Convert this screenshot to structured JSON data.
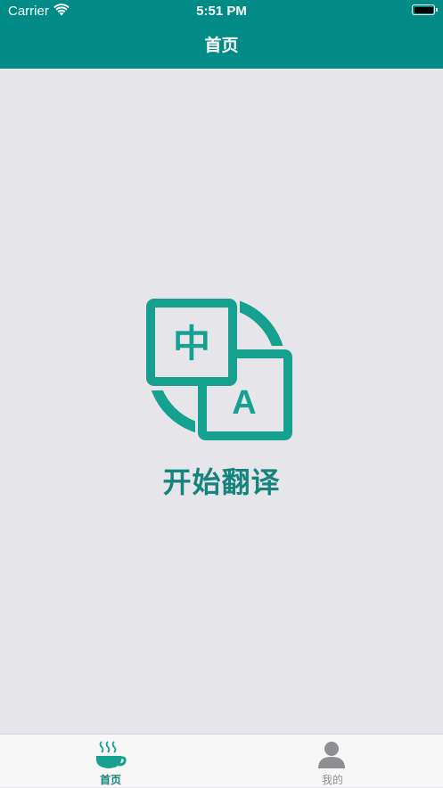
{
  "status_bar": {
    "carrier": "Carrier",
    "time": "5:51 PM"
  },
  "nav": {
    "title": "首页"
  },
  "main": {
    "icon": "translate-icon",
    "icon_chinese_char": "中",
    "icon_latin_char": "A",
    "start_label": "开始翻译"
  },
  "tabs": [
    {
      "label": "首页",
      "icon": "coffee-cup-icon",
      "active": true
    },
    {
      "label": "我的",
      "icon": "person-icon",
      "active": false
    }
  ],
  "colors": {
    "header": "#008b86",
    "accent": "#15a08f",
    "label": "#15847d",
    "background": "#e6e6ea",
    "tab_inactive": "#8e8e93"
  }
}
